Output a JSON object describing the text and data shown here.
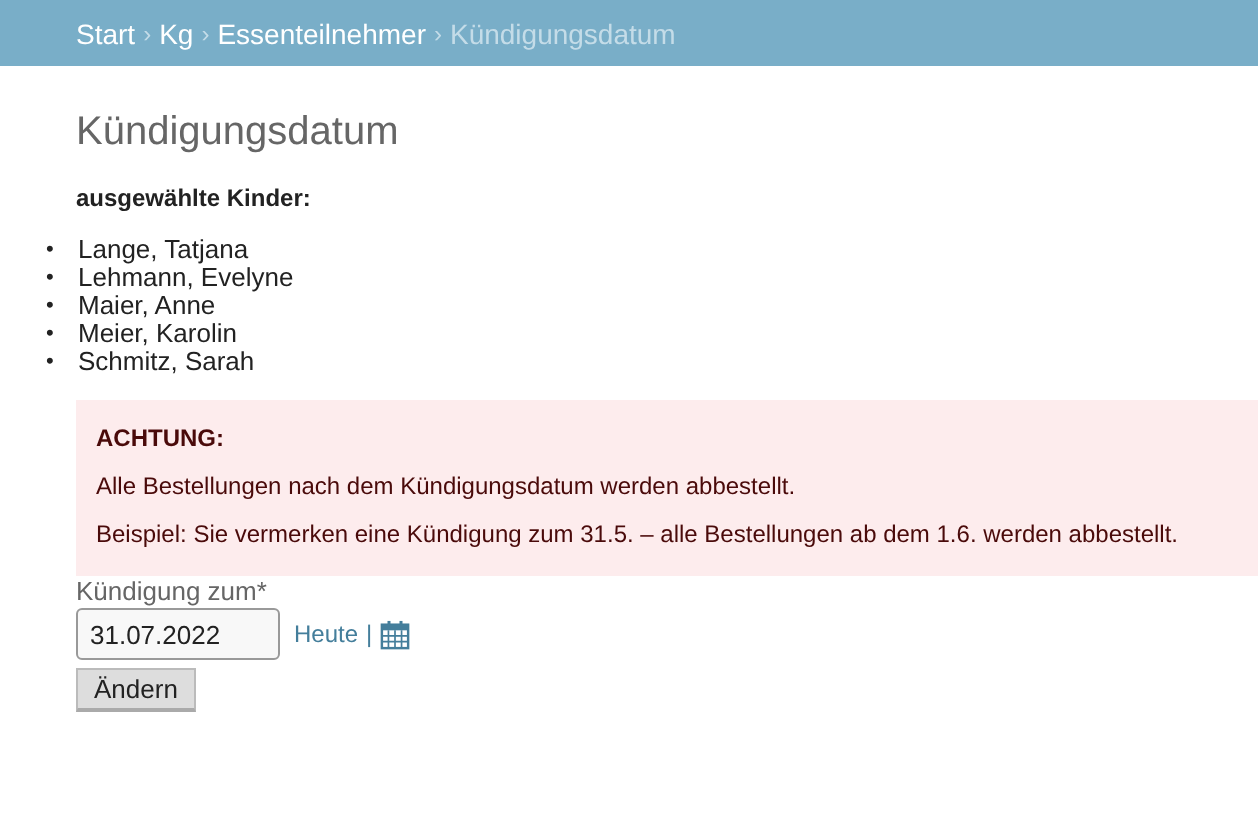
{
  "breadcrumbs": {
    "separator": "›",
    "items": [
      {
        "label": "Start",
        "current": false
      },
      {
        "label": "Kg",
        "current": false
      },
      {
        "label": "Essenteilnehmer",
        "current": false
      },
      {
        "label": "Kündigungsdatum",
        "current": true
      }
    ]
  },
  "title": "Kündigungsdatum",
  "selection_label": "ausgewählte Kinder:",
  "bullet": "•",
  "children": [
    "Lange, Tatjana",
    "Lehmann, Evelyne",
    "Maier, Anne",
    "Meier, Karolin",
    "Schmitz, Sarah"
  ],
  "alert": {
    "heading": "ACHTUNG:",
    "lines": [
      "Alle Bestellungen nach dem Kündigungsdatum werden abbestellt.",
      "Beispiel: Sie vermerken eine Kündigung zum 31.5. – alle Bestellungen ab dem 1.6. werden abbestellt."
    ]
  },
  "form": {
    "label": "Kündigung zum*",
    "value": "31.07.2022",
    "today_link": "Heute",
    "divider": "|",
    "submit": "Ändern"
  }
}
